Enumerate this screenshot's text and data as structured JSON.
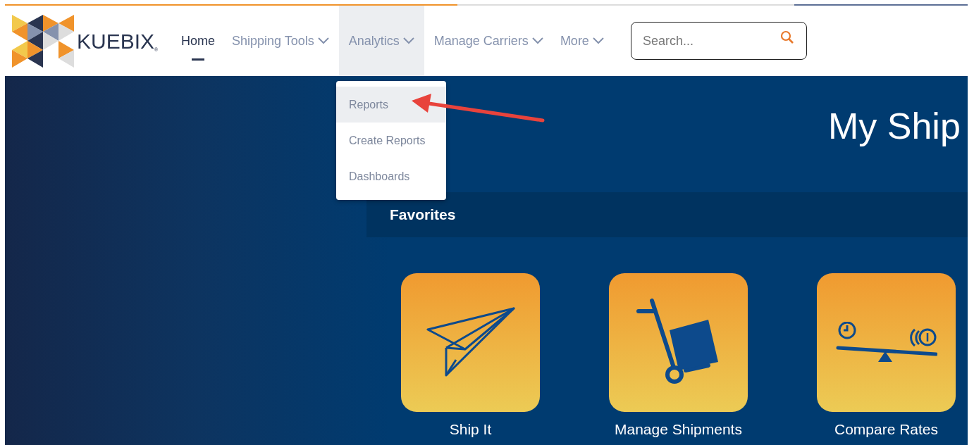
{
  "logo": {
    "text": "KUEBIX",
    "mark": "®"
  },
  "nav": [
    {
      "label": "Home",
      "active": true,
      "expanded": false,
      "dropdown": false
    },
    {
      "label": "Shipping Tools",
      "active": false,
      "expanded": false,
      "dropdown": true
    },
    {
      "label": "Analytics",
      "active": false,
      "expanded": true,
      "dropdown": true
    },
    {
      "label": "Manage Carriers",
      "active": false,
      "expanded": false,
      "dropdown": true
    },
    {
      "label": "More",
      "active": false,
      "expanded": false,
      "dropdown": true
    }
  ],
  "search": {
    "placeholder": "Search..."
  },
  "dropdown_menu": [
    {
      "label": "Reports",
      "selected": true
    },
    {
      "label": "Create Reports",
      "selected": false
    },
    {
      "label": "Dashboards",
      "selected": false
    }
  ],
  "hero": {
    "title": "My Ship"
  },
  "favorites": {
    "heading": "Favorites",
    "tiles": [
      {
        "kind": "plane",
        "label": "Ship It"
      },
      {
        "kind": "cart",
        "label": "Manage Shipments"
      },
      {
        "kind": "scale",
        "label": "Compare Rates"
      }
    ]
  }
}
